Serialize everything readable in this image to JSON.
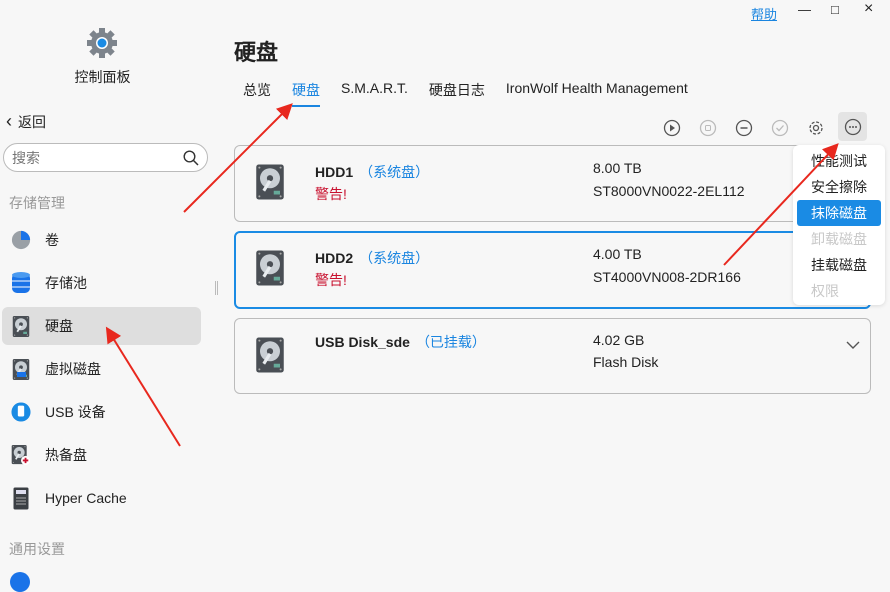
{
  "window": {
    "help": "帮助",
    "minimize": "—",
    "maximize": "□",
    "close": "×"
  },
  "sidebar": {
    "app_label": "控制面板",
    "back": "返回",
    "search_placeholder": "搜索",
    "section_storage": "存储管理",
    "items": [
      {
        "label": "卷",
        "icon": "volume-pie-icon"
      },
      {
        "label": "存储池",
        "icon": "database-icon"
      },
      {
        "label": "硬盘",
        "icon": "hdd-icon",
        "active": true
      },
      {
        "label": "虚拟磁盘",
        "icon": "virtual-disk-icon"
      },
      {
        "label": "USB 设备",
        "icon": "usb-icon"
      },
      {
        "label": "热备盘",
        "icon": "hot-spare-icon"
      },
      {
        "label": "Hyper Cache",
        "icon": "ssd-icon"
      }
    ],
    "section_general": "通用设置"
  },
  "main": {
    "title": "硬盘",
    "tabs": [
      {
        "label": "总览"
      },
      {
        "label": "硬盘",
        "active": true
      },
      {
        "label": "S.M.A.R.T."
      },
      {
        "label": "硬盘日志"
      },
      {
        "label": "IronWolf Health Management"
      }
    ],
    "toolbar": [
      "play-icon",
      "stop-icon",
      "minus-icon",
      "check-icon",
      "gear-icon",
      "more-icon"
    ],
    "disks": [
      {
        "name": "HDD1",
        "tag": "（系统盘）",
        "warning": "警告!",
        "size": "8.00 TB",
        "model": "ST8000VN0022-2EL112"
      },
      {
        "name": "HDD2",
        "tag": "（系统盘）",
        "warning": "警告!",
        "size": "4.00 TB",
        "model": "ST4000VN008-2DR166",
        "selected": true
      },
      {
        "name": "USB Disk_sde",
        "tag": "（已挂载）",
        "warning": "",
        "size": "4.02 GB",
        "model": "Flash Disk"
      }
    ],
    "menu": [
      {
        "label": "性能测试"
      },
      {
        "label": "安全擦除"
      },
      {
        "label": "抹除磁盘",
        "highlighted": true
      },
      {
        "label": "卸载磁盘",
        "disabled": true
      },
      {
        "label": "挂载磁盘"
      },
      {
        "label": "权限",
        "disabled": true
      }
    ]
  },
  "colors": {
    "accent": "#1a8be4",
    "warning": "#c8102e",
    "annotation_arrow": "#e8281e"
  }
}
